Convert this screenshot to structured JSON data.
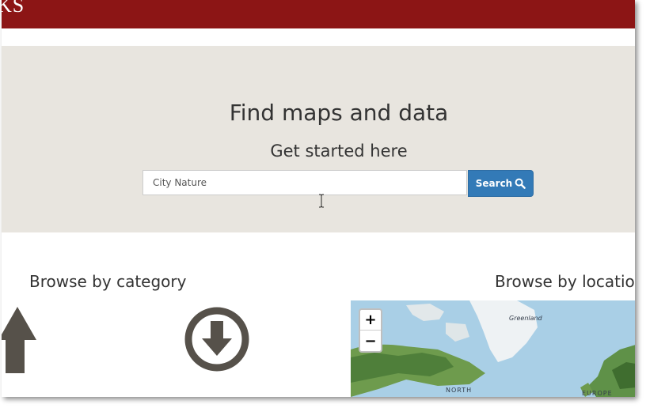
{
  "header": {
    "brand_text": "KS",
    "background": "#8c1515"
  },
  "hero": {
    "title": "Find maps and data",
    "subtitle": "Get started here",
    "search": {
      "value": "City Nature"
    },
    "search_button": {
      "label": "Search",
      "icon": "search-icon",
      "color": "#337ab7"
    },
    "background": "#e8e5df"
  },
  "browse_category": {
    "title": "Browse by category",
    "icons": [
      "up-arrow-icon",
      "download-circle-icon"
    ]
  },
  "browse_location": {
    "title": "Browse by locatio",
    "map": {
      "zoom_in_label": "+",
      "zoom_out_label": "−",
      "labels": {
        "greenland": "Greenland",
        "north": "NORTH",
        "europe": "EUROPE"
      }
    }
  }
}
